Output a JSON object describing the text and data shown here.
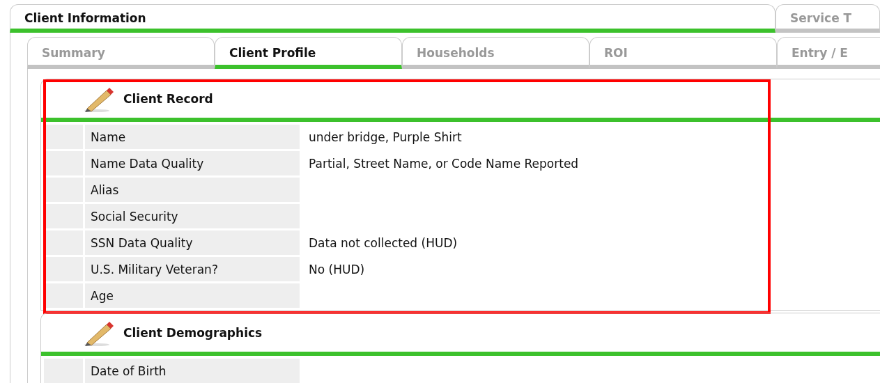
{
  "tabs": [
    {
      "label": "Client Information",
      "selected": true
    },
    {
      "label": "Service T",
      "selected": false
    }
  ],
  "subtabs": [
    {
      "label": "Summary",
      "selected": false
    },
    {
      "label": "Client Profile",
      "selected": true
    },
    {
      "label": "Households",
      "selected": false
    },
    {
      "label": "ROI",
      "selected": false
    },
    {
      "label": "Entry / E",
      "selected": false
    }
  ],
  "sections": [
    {
      "title": "Client Record",
      "highlighted": true,
      "rows": [
        {
          "label": "Name",
          "value": "under bridge, Purple Shirt"
        },
        {
          "label": "Name Data Quality",
          "value": "Partial, Street Name, or Code Name Reported"
        },
        {
          "label": "Alias"
        },
        {
          "label": "Social Security"
        },
        {
          "label": "SSN Data Quality",
          "value": "Data not collected (HUD)"
        },
        {
          "label": "U.S. Military Veteran?",
          "value": "No (HUD)"
        },
        {
          "label": "Age"
        }
      ]
    },
    {
      "title": "Client Demographics",
      "highlighted": false,
      "rows": [
        {
          "label": "Date of Birth"
        }
      ]
    }
  ]
}
